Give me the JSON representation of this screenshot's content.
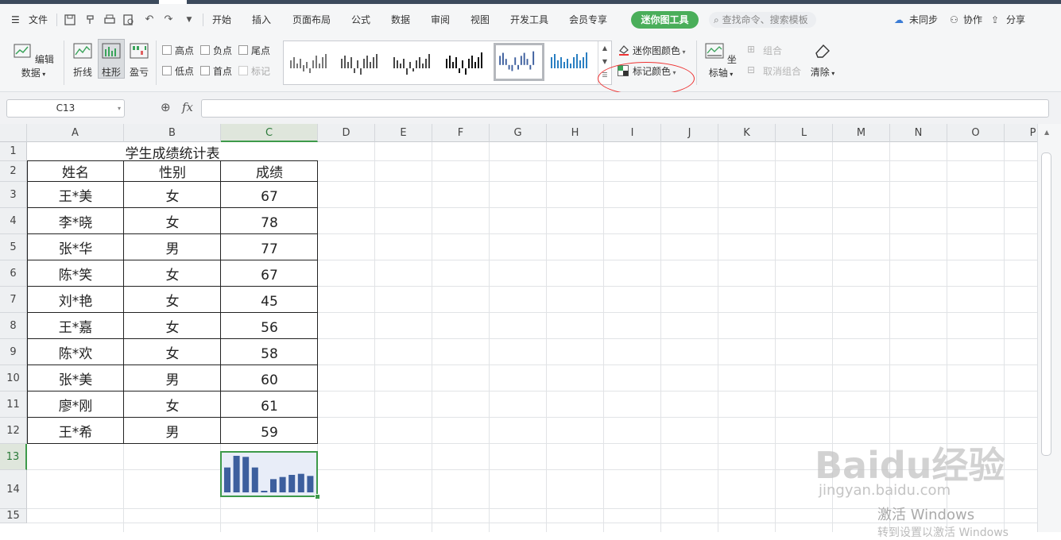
{
  "menubar": {
    "file": "文件",
    "tabs": [
      "开始",
      "插入",
      "页面布局",
      "公式",
      "数据",
      "审阅",
      "视图",
      "开发工具",
      "会员专享"
    ],
    "active_tool": "迷你图工具",
    "search_placeholder": "查找命令、搜索模板",
    "sync": "未同步",
    "collab": "协作",
    "share": "分享"
  },
  "ribbon": {
    "edit_data": "编辑数据",
    "line": "折线",
    "column": "柱形",
    "winloss": "盈亏",
    "high_point": "高点",
    "neg_point": "负点",
    "last_point": "尾点",
    "low_point": "低点",
    "first_point": "首点",
    "markers": "标记",
    "sparkline_color": "迷你图颜色",
    "marker_color": "标记颜色",
    "axis": "坐标轴",
    "group": "组合",
    "ungroup": "取消组合",
    "clear": "清除"
  },
  "formula_bar": {
    "cell_ref": "C13",
    "fx": "fx",
    "content": ""
  },
  "columns": [
    "A",
    "B",
    "C",
    "D",
    "E",
    "F",
    "G",
    "H",
    "I",
    "J",
    "K",
    "L",
    "M",
    "N",
    "O",
    "P"
  ],
  "rows": [
    "1",
    "2",
    "3",
    "4",
    "5",
    "6",
    "7",
    "8",
    "9",
    "10",
    "11",
    "12",
    "13",
    "14",
    "15"
  ],
  "table": {
    "title": "学生成绩统计表",
    "headers": [
      "姓名",
      "性别",
      "成绩"
    ],
    "rows": [
      [
        "王*美",
        "女",
        "67"
      ],
      [
        "李*晓",
        "女",
        "78"
      ],
      [
        "张*华",
        "男",
        "77"
      ],
      [
        "陈*笑",
        "女",
        "67"
      ],
      [
        "刘*艳",
        "女",
        "45"
      ],
      [
        "王*嘉",
        "女",
        "56"
      ],
      [
        "陈*欢",
        "女",
        "58"
      ],
      [
        "张*美",
        "男",
        "60"
      ],
      [
        "廖*刚",
        "女",
        "61"
      ],
      [
        "王*希",
        "男",
        "59"
      ]
    ]
  },
  "sparkline": {
    "values": [
      67,
      78,
      77,
      67,
      45,
      56,
      58,
      60,
      61,
      59
    ],
    "color": "#3d5f9e",
    "selected_fill": "#e8edf8",
    "selection_border": "#3d9a4a"
  },
  "watermark": {
    "brand": "Baidu经验",
    "url": "jingyan.baidu.com",
    "activate": "激活 Windows",
    "activate_sub": "转到设置以激活 Windows"
  },
  "colors": {
    "accent_green": "#4aae5a",
    "annotation_red": "#e33333"
  }
}
